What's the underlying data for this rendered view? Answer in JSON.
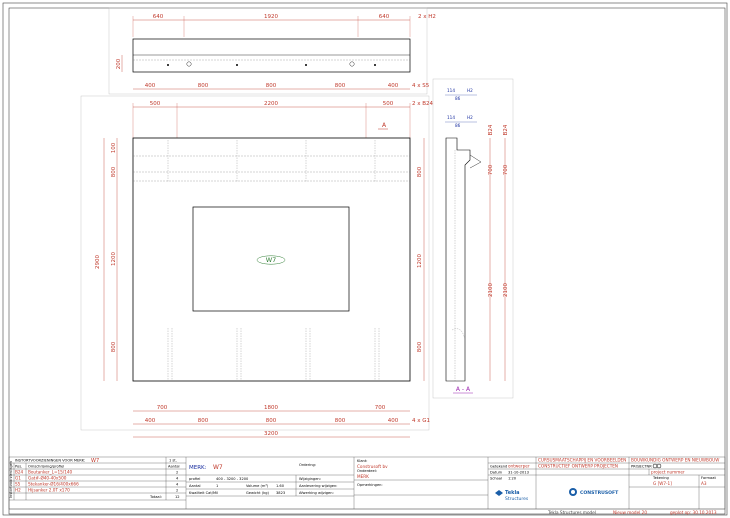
{
  "top_view": {
    "dims_top": [
      "640",
      "1920",
      "640"
    ],
    "dims_top_note": "2 x H2",
    "height_dim": "200",
    "dims_bottom": [
      "400",
      "800",
      "800",
      "800",
      "400"
    ],
    "dims_bottom_note": "4 x S5"
  },
  "front_view": {
    "dims_top": [
      "500",
      "2200",
      "500"
    ],
    "dims_top_note": "2 x B24",
    "section_mark": "A",
    "left_outer": "2900",
    "left_inner": [
      "100",
      "800",
      "1200",
      "800"
    ],
    "right_inner": [
      "800",
      "1200",
      "800"
    ],
    "element_mark": "W7",
    "dims_bottom1": [
      "700",
      "1800",
      "700"
    ],
    "dims_bottom2": [
      "400",
      "800",
      "800",
      "800",
      "400"
    ],
    "dims_bottom2_note": "4 x G1",
    "dims_total": "3200"
  },
  "section_view": {
    "dims_a": [
      "114",
      "H2",
      "86"
    ],
    "dims_b": [
      "114",
      "H2",
      "86"
    ],
    "side_labels": [
      "B24",
      "B24"
    ],
    "right_dims": [
      "700",
      "2100"
    ],
    "right_dims2": [
      "700",
      "2100"
    ],
    "section_label": "A - A"
  },
  "parts_table": {
    "title": "INSTORTVOORZIENINGEN VOOR MERK:",
    "merk": "W7",
    "unit": "1 st.",
    "col_pos": "Pos.",
    "col_desc": "Omschrijving/profiel",
    "col_qty": "Aantal",
    "rows": [
      {
        "pos": "B24",
        "desc": "Boutanker_L=15/140",
        "qty": "2"
      },
      {
        "pos": "G1",
        "desc": "Gat#-Ø40-40x500",
        "qty": "4"
      },
      {
        "pos": "S5",
        "desc": "Stekanker-Ø16/400x666",
        "qty": "4"
      },
      {
        "pos": "H2",
        "desc": "Hijsanker 2.0T x170",
        "qty": "2"
      }
    ],
    "total_label": "Totaal:",
    "total_value": "12",
    "side_label": "Instortvoorzieningen"
  },
  "merk_block": {
    "label": "MERK:",
    "merk": "W7",
    "profiel_label": "profiel",
    "profiel": "400 - 3200 - 3200",
    "aantal_label": "Aantal",
    "aantal": "1",
    "volume_label": "Volume (m³)",
    "volume": "1.60",
    "kwaliteit_label": "Kwaliteit Cat/Mil",
    "gewicht_label": "Gewicht (kg)",
    "gewicht": "3823",
    "ordering": "Ordering:",
    "f1": "Wijzigingen:",
    "f2": "Aanlevering wijzigen:",
    "f3": "Afwerking wijzigen:"
  },
  "project_block": {
    "name_label": "Klant:",
    "company": "Construsoft bv",
    "element_label": "Onderdeel:",
    "element": "MERK",
    "remarks_label": "Opmerkingen:"
  },
  "drawing_info": {
    "labels": [
      "Getekend",
      "Datum",
      "Schaal"
    ],
    "values": [
      "ontwerper",
      "31-10-2013",
      "1:20"
    ],
    "line1": "CURSUSMAATSCHAPPIJ EN VOORBEELDEN",
    "line2": "CONSTRUCTIEF ONTWERP PROJECTEN",
    "line3": "BOUWKUNDIG ONTWERP EN NIEUWBOUW",
    "projectno_label": "PROJECTNR",
    "project_name": "project nummer",
    "tekening_label": "Tekening",
    "tekening": "G [W7-1]",
    "formaat_label": "Formaat",
    "formaat": "A3"
  },
  "brands": {
    "tekla": "Tekla",
    "tekla_sub": "Structures",
    "construsoft": "CONSTRUSOFT"
  },
  "footer": {
    "source": "Tekla Structures model",
    "model": "Nieuw model 20",
    "date": "geplot op: 30.10.2013"
  }
}
